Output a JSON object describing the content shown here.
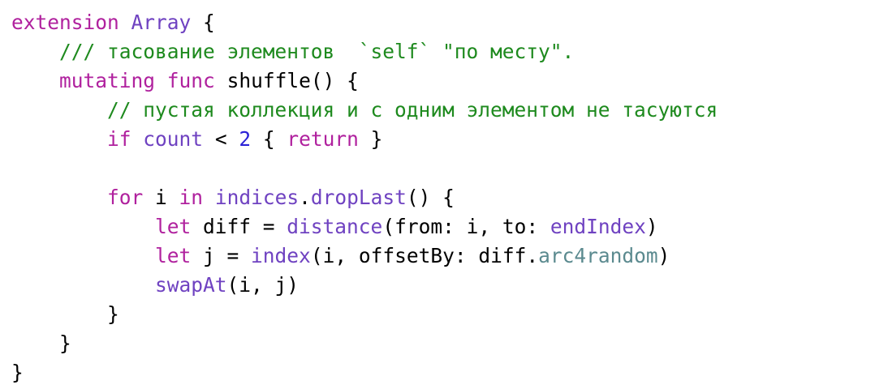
{
  "colors": {
    "keyword": "#b0219e",
    "type_or_member": "#6f42c1",
    "comment": "#1e8a1e",
    "number": "#2b22d6",
    "library_method": "#5b8a8f",
    "plain": "#000000",
    "background": "#ffffff"
  },
  "code": {
    "language": "swift",
    "lines": [
      {
        "indent": 0,
        "tokens": [
          {
            "t": "extension",
            "k": "kw"
          },
          {
            "t": " ",
            "k": "plain"
          },
          {
            "t": "Array",
            "k": "type"
          },
          {
            "t": " {",
            "k": "plain"
          }
        ]
      },
      {
        "indent": 4,
        "tokens": [
          {
            "t": "/// тасование элементов  `self` \"по месту\".",
            "k": "comment"
          }
        ]
      },
      {
        "indent": 4,
        "tokens": [
          {
            "t": "mutating",
            "k": "kw"
          },
          {
            "t": " ",
            "k": "plain"
          },
          {
            "t": "func",
            "k": "kw"
          },
          {
            "t": " shuffle() {",
            "k": "plain"
          }
        ]
      },
      {
        "indent": 8,
        "tokens": [
          {
            "t": "// пустая коллекция и с одним элементом не тасуются",
            "k": "comment"
          }
        ]
      },
      {
        "indent": 8,
        "tokens": [
          {
            "t": "if",
            "k": "kw"
          },
          {
            "t": " ",
            "k": "plain"
          },
          {
            "t": "count",
            "k": "type"
          },
          {
            "t": " < ",
            "k": "plain"
          },
          {
            "t": "2",
            "k": "num"
          },
          {
            "t": " { ",
            "k": "plain"
          },
          {
            "t": "return",
            "k": "kw"
          },
          {
            "t": " }",
            "k": "plain"
          }
        ]
      },
      {
        "indent": 0,
        "tokens": []
      },
      {
        "indent": 8,
        "tokens": [
          {
            "t": "for",
            "k": "kw"
          },
          {
            "t": " i ",
            "k": "plain"
          },
          {
            "t": "in",
            "k": "kw"
          },
          {
            "t": " ",
            "k": "plain"
          },
          {
            "t": "indices",
            "k": "type"
          },
          {
            "t": ".",
            "k": "plain"
          },
          {
            "t": "dropLast",
            "k": "type"
          },
          {
            "t": "() {",
            "k": "plain"
          }
        ]
      },
      {
        "indent": 12,
        "tokens": [
          {
            "t": "let",
            "k": "kw"
          },
          {
            "t": " diff = ",
            "k": "plain"
          },
          {
            "t": "distance",
            "k": "type"
          },
          {
            "t": "(from: i, to: ",
            "k": "plain"
          },
          {
            "t": "endIndex",
            "k": "type"
          },
          {
            "t": ")",
            "k": "plain"
          }
        ]
      },
      {
        "indent": 12,
        "tokens": [
          {
            "t": "let",
            "k": "kw"
          },
          {
            "t": " j = ",
            "k": "plain"
          },
          {
            "t": "index",
            "k": "type"
          },
          {
            "t": "(i, offsetBy: diff.",
            "k": "plain"
          },
          {
            "t": "arc4random",
            "k": "method"
          },
          {
            "t": ")",
            "k": "plain"
          }
        ]
      },
      {
        "indent": 12,
        "tokens": [
          {
            "t": "swapAt",
            "k": "type"
          },
          {
            "t": "(i, j)",
            "k": "plain"
          }
        ]
      },
      {
        "indent": 8,
        "tokens": [
          {
            "t": "}",
            "k": "plain"
          }
        ]
      },
      {
        "indent": 4,
        "tokens": [
          {
            "t": "}",
            "k": "plain"
          }
        ]
      },
      {
        "indent": 0,
        "tokens": [
          {
            "t": "}",
            "k": "plain"
          }
        ]
      }
    ]
  }
}
